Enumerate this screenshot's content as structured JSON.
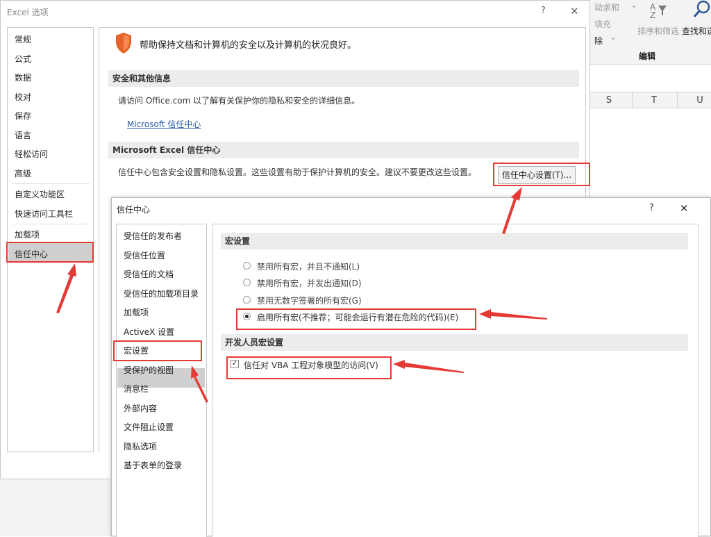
{
  "excel_ribbon": {
    "partial_autosum": "动求和",
    "partial_fill": "填充",
    "partial_clear": "除",
    "sort_filter": "排序和筛选",
    "find_select": "查找和选",
    "group_label": "编辑",
    "columns": [
      "S",
      "T",
      "U"
    ]
  },
  "options_dialog": {
    "title": "Excel 选项",
    "help": "?",
    "close": "✕",
    "nav": [
      "常规",
      "公式",
      "数据",
      "校对",
      "保存",
      "语言",
      "轻松访问",
      "高级",
      "自定义功能区",
      "快速访问工具栏",
      "加载项",
      "信任中心"
    ],
    "selected_nav": "信任中心",
    "header_text": "帮助保持文档和计算机的安全以及计算机的状况良好。",
    "section1_title": "安全和其他信息",
    "section1_text": "请访问 Office.com 以了解有关保护你的隐私和安全的详细信息。",
    "section1_link": "Microsoft 信任中心",
    "section2_title": "Microsoft Excel 信任中心",
    "section2_text": "信任中心包含安全设置和隐私设置。这些设置有助于保护计算机的安全。建议不要更改这些设置。",
    "settings_button": "信任中心设置(T)..."
  },
  "trust_center": {
    "title": "信任中心",
    "help": "?",
    "close": "✕",
    "nav": [
      "受信任的发布者",
      "受信任位置",
      "受信任的文档",
      "受信任的加载项目录",
      "加载项",
      "ActiveX 设置",
      "宏设置",
      "受保护的视图",
      "消息栏",
      "外部内容",
      "文件阻止设置",
      "隐私选项",
      "基于表单的登录"
    ],
    "selected_nav": "宏设置",
    "macro_section": "宏设置",
    "macro_options": [
      {
        "label": "禁用所有宏，并且不通知(L)",
        "checked": false
      },
      {
        "label": "禁用所有宏，并发出通知(D)",
        "checked": false
      },
      {
        "label": "禁用无数字签署的所有宏(G)",
        "checked": false
      },
      {
        "label": "启用所有宏(不推荐；可能会运行有潜在危险的代码)(E)",
        "checked": true
      }
    ],
    "dev_section": "开发人员宏设置",
    "vba_check_label": "信任对 VBA 工程对象模型的访问(V)",
    "vba_checked": true
  },
  "colors": {
    "annotation_red": "#e53935",
    "shield_orange": "#e8632b",
    "link_blue": "#2a5da8",
    "selected_gray": "#cfcfcf"
  }
}
